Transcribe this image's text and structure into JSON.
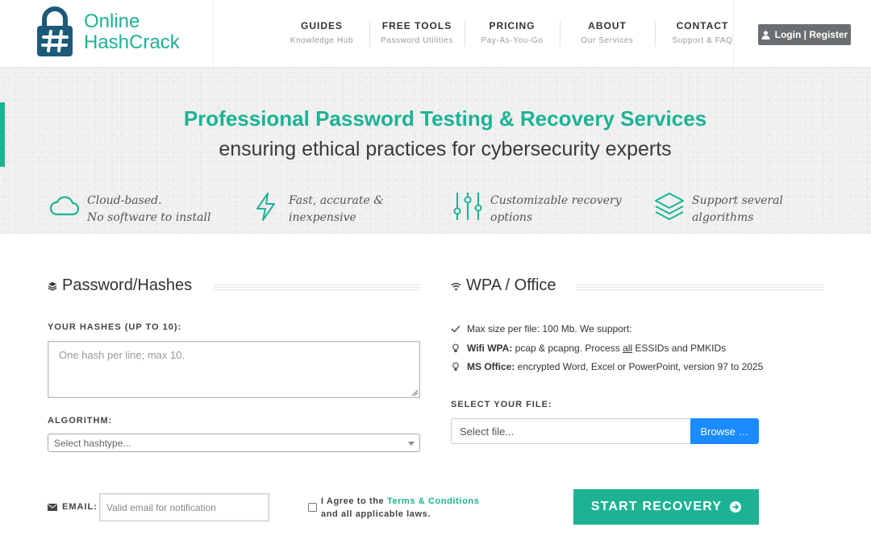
{
  "brand": {
    "logo_line1": "Online",
    "logo_line2": "HashCrack",
    "accent_color": "#1bb394"
  },
  "nav": {
    "items": [
      {
        "title": "GUIDES",
        "sub": "Knowledge Hub"
      },
      {
        "title": "FREE TOOLS",
        "sub": "Password Utilities"
      },
      {
        "title": "PRICING",
        "sub": "Pay-As-You-Go"
      },
      {
        "title": "ABOUT",
        "sub": "Our Services"
      },
      {
        "title": "CONTACT",
        "sub": "Support & FAQ"
      }
    ],
    "login_label": "Login | Register",
    "login_icon": "user-icon"
  },
  "hero": {
    "title": "Professional Password Testing & Recovery Services",
    "subtitle": "ensuring ethical practices for cybersecurity experts",
    "features": [
      {
        "icon": "cloud-icon",
        "line1": "Cloud-based.",
        "line2": "No software to install"
      },
      {
        "icon": "lightning-icon",
        "line1": "Fast, accurate &",
        "line2": "inexpensive"
      },
      {
        "icon": "sliders-icon",
        "line1": "Customizable recovery",
        "line2": "options"
      },
      {
        "icon": "layers-icon",
        "line1": "Support several",
        "line2": "algorithms"
      }
    ]
  },
  "left_section": {
    "title": "Password/Hashes",
    "hashes_label": "YOUR HASHES (UP TO 10):",
    "hashes_placeholder": "One hash per line; max 10.",
    "algorithm_label": "ALGORITHM:",
    "algorithm_placeholder": "Select hashtype..."
  },
  "right_section": {
    "title": "WPA / Office",
    "info": {
      "max_size": "Max size per file: 100 Mb. We support:",
      "wifi_label": "Wifi WPA:",
      "wifi_text_a": " pcap & pcapng. Process ",
      "wifi_all": "all",
      "wifi_text_b": " ESSIDs and PMKIDs",
      "office_label": "MS Office:",
      "office_text": " encrypted Word, Excel or PowerPoint, version 97 to 2025"
    },
    "file_label": "SELECT YOUR FILE:",
    "file_placeholder": "Select file...",
    "browse_label": "Browse …"
  },
  "footer_form": {
    "email_label": "EMAIL:",
    "email_placeholder": "Valid email for notification",
    "agree_prefix": "I Agree to the ",
    "terms_link": "Terms & Conditions",
    "agree_suffix": "and all applicable laws.",
    "start_label": "START RECOVERY"
  }
}
